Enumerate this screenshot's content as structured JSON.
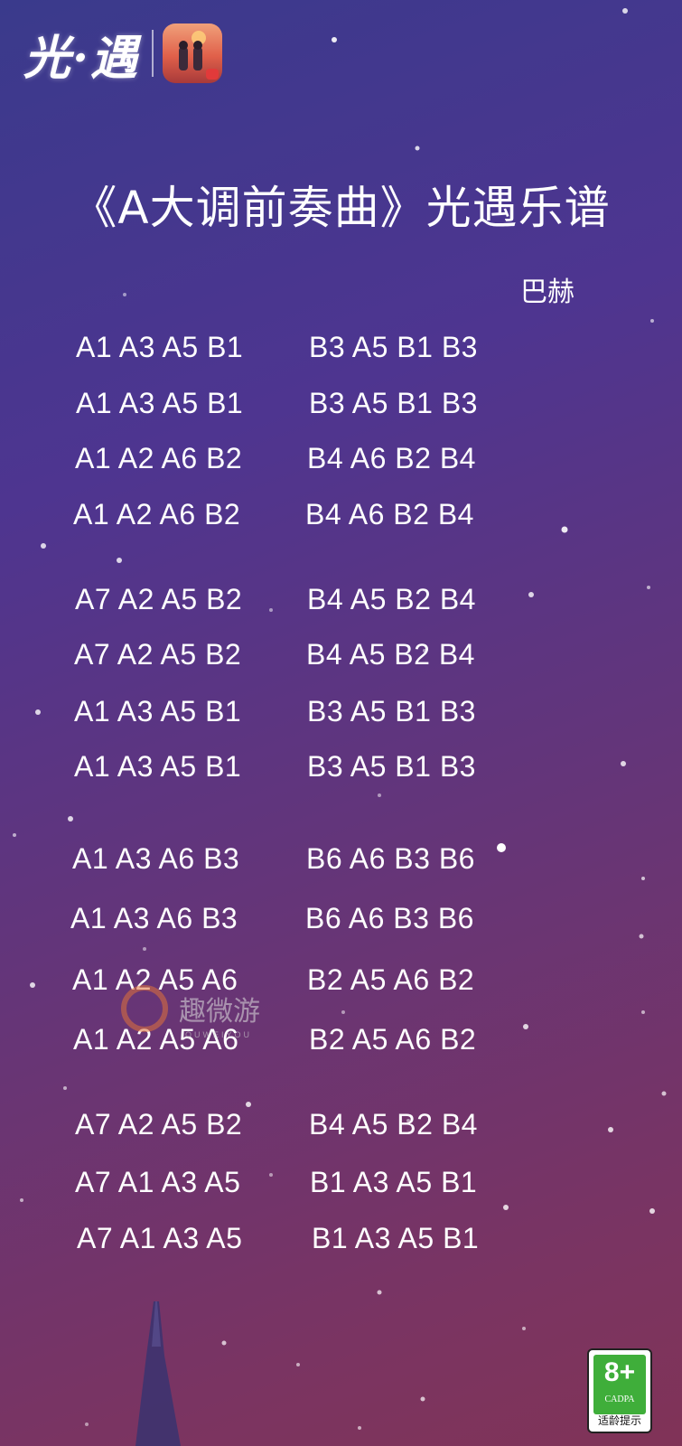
{
  "logo": {
    "text": "光·遇"
  },
  "title": "《A大调前奏曲》光遇乐谱",
  "composer": "巴赫",
  "score": {
    "left": [
      "A1 A3 A5 B1",
      "A1 A3 A5 B1",
      "A1 A2 A6 B2",
      "A1 A2 A6 B2",
      "A7 A2 A5 B2",
      "A7 A2 A5 B2",
      "A1 A3 A5 B1",
      "A1 A3 A5 B1",
      "A1 A3 A6 B3",
      "A1 A3 A6 B3",
      "A1 A2 A5 A6",
      "A1 A2 A5 A6",
      "A7 A2 A5 B2",
      "A7 A1 A3 A5",
      "A7 A1 A3 A5"
    ],
    "right": [
      "B3 A5 B1 B3",
      "B3 A5 B1 B3",
      "B4 A6 B2 B4",
      "B4 A6 B2 B4",
      "B4 A5 B2 B4",
      "B4 A5 B2 B4",
      "B3 A5 B1 B3",
      "B3 A5 B1 B3",
      "B6 A6 B3 B6",
      "B6 A6 B3 B6",
      "B2 A5 A6 B2",
      "B2 A5 A6 B2",
      "B4 A5 B2 B4",
      "B1 A3 A5 B1",
      "B1 A3 A5 B1"
    ]
  },
  "watermark": {
    "text": "趣微游",
    "sub": "QUWEIYOU"
  },
  "age_rating": {
    "label": "8+",
    "org": "CADPA",
    "tip": "适龄提示",
    "color": "#3fae3a"
  }
}
